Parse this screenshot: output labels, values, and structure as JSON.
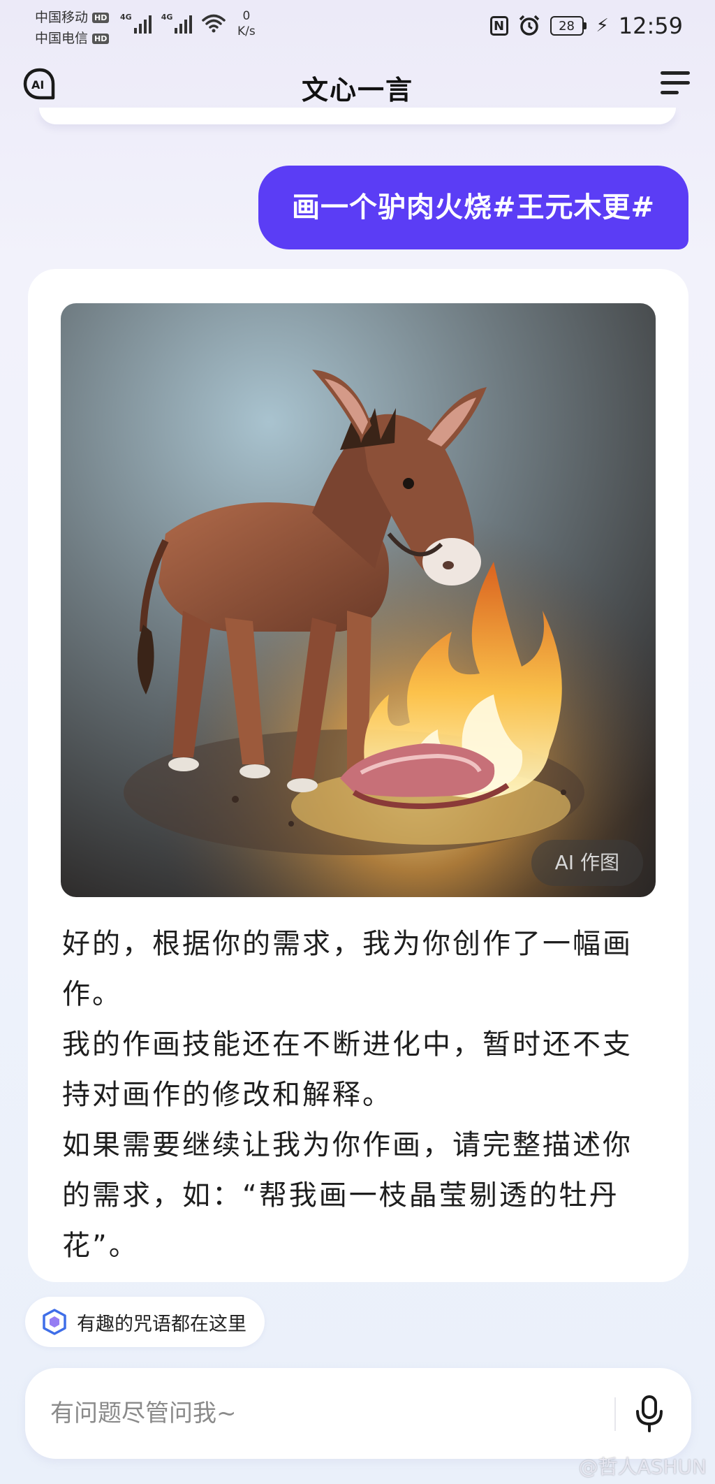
{
  "status_bar": {
    "carrier_1": "中国移动",
    "carrier_2": "中国电信",
    "hd_badge": "HD",
    "network_type": "4G",
    "speed_value": "0",
    "speed_unit": "K/s",
    "battery_level": "28",
    "time": "12:59"
  },
  "header": {
    "logo_text": "AI",
    "title": "文心一言"
  },
  "conversation": {
    "user_message": "画一个驴肉火烧#王元木更#",
    "bot_image_badge": "AI 作图",
    "bot_reply": [
      "好的，根据你的需求，我为你创作了一幅画作。",
      "我的作画技能还在不断进化中，暂时还不支持对画作的修改和解释。",
      "如果需要继续让我为你作画，请完整描述你的需求，如：“帮我画一枝晶莹剔透的牡丹花”。"
    ]
  },
  "suggestion_chip": {
    "label": "有趣的咒语都在这里"
  },
  "input": {
    "placeholder": "有问题尽管问我~"
  },
  "credit": {
    "text": "@哲人ASHUN"
  },
  "colors": {
    "accent": "#5b3df5",
    "card": "#ffffff",
    "background": "#eef0fa"
  },
  "icons": {
    "logo": "ai-chat-bubble-icon",
    "menu": "menu-icon",
    "chip": "cube-icon",
    "mic": "microphone-icon"
  }
}
